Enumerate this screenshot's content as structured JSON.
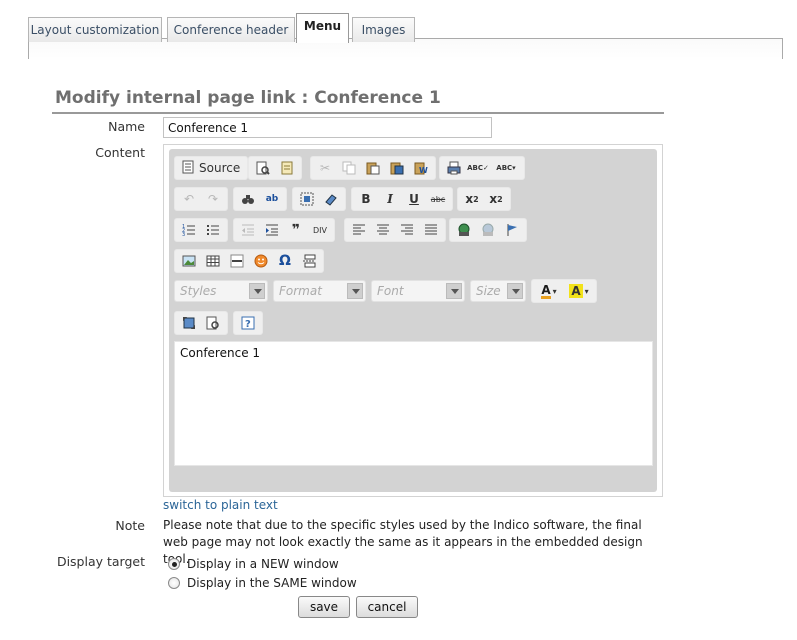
{
  "tabs": [
    {
      "label": "Layout customization",
      "active": false
    },
    {
      "label": "Conference header",
      "active": false
    },
    {
      "label": "Menu",
      "active": true
    },
    {
      "label": "Images",
      "active": false
    }
  ],
  "page_title": "Modify internal page link : Conference 1",
  "form": {
    "name_label": "Name",
    "name_value": "Conference 1",
    "content_label": "Content",
    "note_label": "Note",
    "display_target_label": "Display target"
  },
  "editor": {
    "source_label": "Source",
    "combos": {
      "styles": "Styles",
      "format": "Format",
      "font": "Font",
      "size": "Size"
    },
    "content": "Conference 1",
    "switch_link": "switch to plain text"
  },
  "note_text": "Please note that due to the specific styles used by the Indico software, the final web page may not look exactly the same as it appears in the embedded design tool.",
  "display_target": {
    "options": [
      {
        "label": "Display in a NEW window",
        "selected": true
      },
      {
        "label": "Display in the SAME window",
        "selected": false
      }
    ]
  },
  "buttons": {
    "save": "save",
    "cancel": "cancel"
  },
  "colors": {
    "link": "#2b6597",
    "title": "#6f6f6f",
    "toolbar_bg": "#d3d3d3"
  }
}
